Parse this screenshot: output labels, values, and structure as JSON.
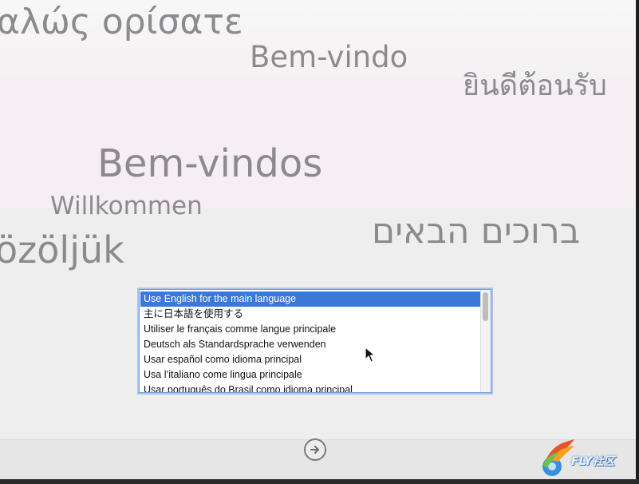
{
  "greetings": {
    "greek": "αλώς ορίσατε",
    "portuguese": "Bem-vindo",
    "thai": "ยินดีต้อนรับ",
    "portuguese_plural": "Bem-vindos",
    "german": "Willkommen",
    "hebrew": "ברוכים הבאים",
    "hungarian": "özöljük"
  },
  "language_list": {
    "selected_index": 0,
    "items": [
      "Use English for the main language",
      "主に日本語を使用する",
      "Utiliser le français comme langue principale",
      "Deutsch als Standardsprache verwenden",
      "Usar español como idioma principal",
      "Usa l’italiano come lingua principale",
      "Usar português do Brasil como idioma principal"
    ]
  },
  "icons": {
    "next": "arrow-right-circle-icon",
    "cursor": "mouse-pointer-icon"
  },
  "watermark": {
    "text": "FLY社区",
    "sub": "bbs.fly.cn"
  },
  "colors": {
    "selection": "#3b78d8",
    "greeting_text": "#8b8a8c"
  }
}
